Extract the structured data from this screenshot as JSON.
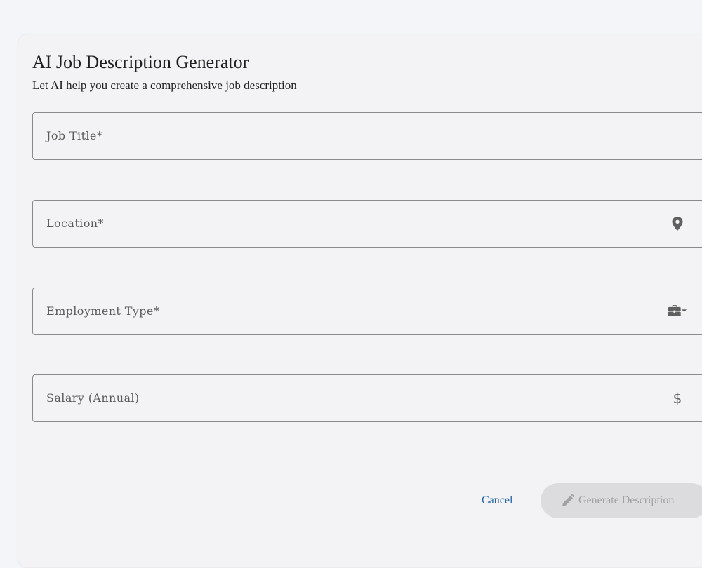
{
  "header": {
    "title": "AI Job Description Generator",
    "subtitle": "Let AI help you create a comprehensive job description"
  },
  "form": {
    "job_title": {
      "label": "Job Title*",
      "value": ""
    },
    "location": {
      "label": "Location*",
      "value": "",
      "icon": "location-pin-icon"
    },
    "employment_type": {
      "label": "Employment Type*",
      "value": "",
      "icon": "briefcase-dropdown-icon"
    },
    "salary": {
      "label": "Salary (Annual)",
      "value": "",
      "icon": "dollar-icon",
      "icon_text": "$"
    }
  },
  "actions": {
    "cancel_label": "Cancel",
    "generate_label": "Generate Description",
    "generate_icon": "pencil-icon",
    "generate_disabled": true
  },
  "colors": {
    "link_blue": "#1f5fa6",
    "disabled_bg": "#dcdcde",
    "disabled_text": "#a1a1a4"
  }
}
